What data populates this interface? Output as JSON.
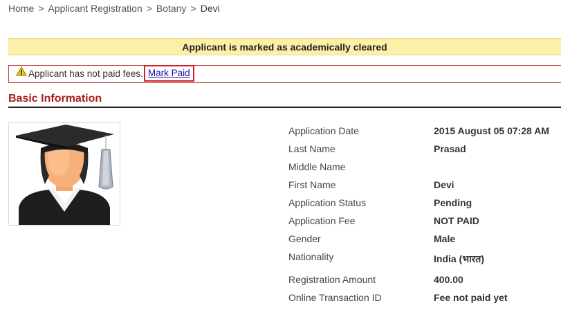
{
  "breadcrumb": {
    "items": [
      "Home",
      "Applicant Registration",
      "Botany"
    ],
    "current": "Devi",
    "separator": ">"
  },
  "notices": {
    "cleared": "Applicant is marked as academically cleared",
    "fees_text": "Applicant has not paid fees.",
    "mark_paid_label": "Mark Paid",
    "warning_icon": "warning-triangle-icon"
  },
  "section": {
    "title": "Basic Information"
  },
  "avatar": {
    "icon": "graduate-avatar-icon"
  },
  "fields": [
    {
      "label": "Application Date",
      "value": "2015 August 05 07:28 AM"
    },
    {
      "label": "Last Name",
      "value": "Prasad"
    },
    {
      "label": "Middle Name",
      "value": ""
    },
    {
      "label": "First Name",
      "value": "Devi"
    },
    {
      "label": "Application Status",
      "value": "Pending"
    },
    {
      "label": "Application Fee",
      "value": "NOT PAID"
    },
    {
      "label": "Gender",
      "value": "Male"
    },
    {
      "label": "Nationality",
      "value": "India (भारत)"
    },
    {
      "label": "Registration Amount",
      "value": "400.00"
    },
    {
      "label": "Online Transaction ID",
      "value": "Fee not paid yet"
    }
  ],
  "colors": {
    "accent_red": "#a61c1c",
    "highlight_border": "#d81f26",
    "notice_bg": "#fcf0a8",
    "link": "#1a0dab"
  }
}
